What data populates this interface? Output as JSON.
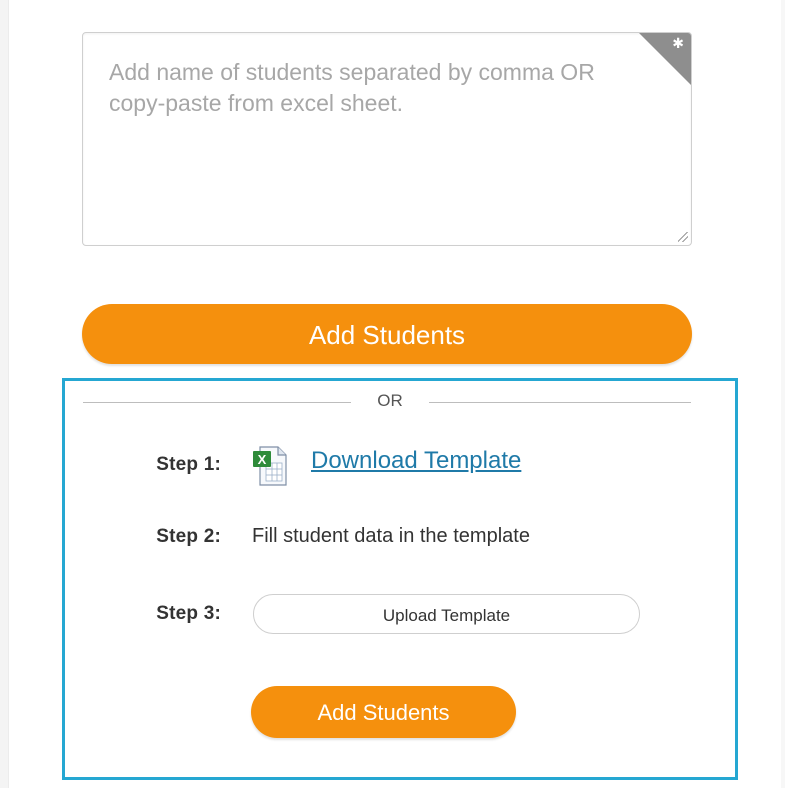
{
  "textarea": {
    "placeholder": "Add name of students separated by comma OR copy-paste from excel sheet.",
    "value": ""
  },
  "add_students_main": {
    "label": "Add Students"
  },
  "upload_section": {
    "or_text": "OR",
    "step1": {
      "label": "Step 1:",
      "link_text": "Download Template",
      "icon": "excel-icon"
    },
    "step2": {
      "label": "Step 2:",
      "text": "Fill student data in the template"
    },
    "step3": {
      "label": "Step 3:",
      "button_label": "Upload Template"
    },
    "add_students_button": {
      "label": "Add Students"
    }
  },
  "colors": {
    "accent": "#f5900d",
    "box_border": "#25a7d2",
    "link": "#1f7aa8"
  }
}
